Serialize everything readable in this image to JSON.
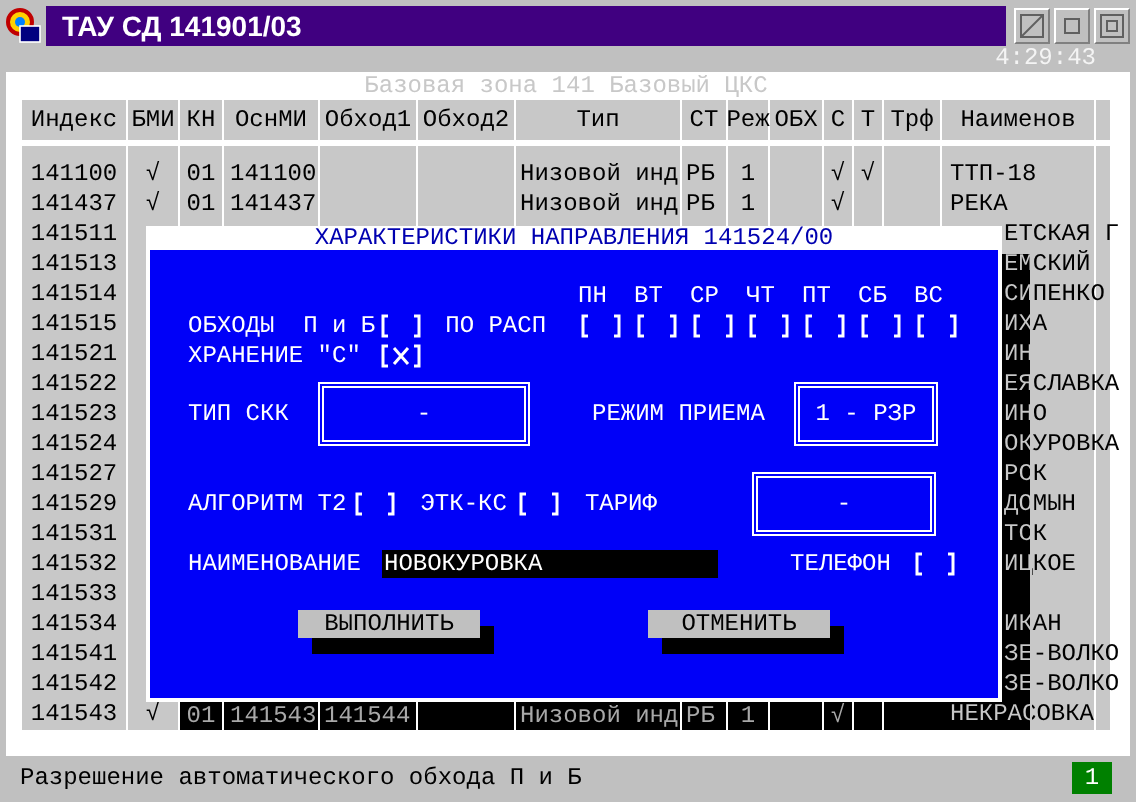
{
  "window": {
    "title": "ТАУ СД 141901/03",
    "clock": "4:29:43"
  },
  "zone_caption": "Базовая зона 141 Базовый ЦКС",
  "table": {
    "columns": [
      "Индекс",
      "БМИ",
      "КН",
      "ОснМИ",
      "Обход1",
      "Обход2",
      "Тип",
      "СТ",
      "Реж",
      "ОБХ",
      "С",
      "Т",
      "Трф",
      "Наименов"
    ],
    "rows": [
      {
        "index": "141100",
        "bmi": "√",
        "kn": "01",
        "osn_mi": "141100",
        "type": "Низовой инд",
        "st": "РБ",
        "mode": "1",
        "c": "√",
        "t": "√",
        "name": "ТТП-18"
      },
      {
        "index": "141437",
        "bmi": "√",
        "kn": "01",
        "osn_mi": "141437",
        "type": "Низовой инд",
        "st": "РБ",
        "mode": "1",
        "c": "√",
        "name": "РЕКА"
      },
      {
        "index": "141511",
        "name": "ЕТСКАЯ Г"
      },
      {
        "index": "141513",
        "name": "ЕМСКИЙ"
      },
      {
        "index": "141514",
        "name": "СИПЕНКО"
      },
      {
        "index": "141515",
        "name": "ИХА"
      },
      {
        "index": "141521",
        "name": "ИН"
      },
      {
        "index": "141522",
        "name": "ЕЯСЛАВКА"
      },
      {
        "index": "141523",
        "name": "ИНО"
      },
      {
        "index": "141524",
        "name": "ОКУРОВКА"
      },
      {
        "index": "141527",
        "name": "РСК"
      },
      {
        "index": "141529",
        "name": "ДОМЫН"
      },
      {
        "index": "141531",
        "name": "ТСК"
      },
      {
        "index": "141532",
        "name": "ИЦКОЕ"
      },
      {
        "index": "141533"
      },
      {
        "index": "141534",
        "name": "ИКАН"
      },
      {
        "index": "141541",
        "name": "ЗЕ-ВОЛКО"
      },
      {
        "index": "141542",
        "name": "ЗЕ-ВОЛКО"
      },
      {
        "index": "141543",
        "bmi": "√",
        "kn": "01",
        "osn_mi": "141543",
        "bypass1": "141544",
        "type": "Низовой инд",
        "st": "РБ",
        "mode": "1",
        "c": "√",
        "name": "НЕКРАСОВКА"
      }
    ]
  },
  "dialog": {
    "title": "ХАРАКТЕРИСТИКИ НАПРАВЛЕНИЯ 141524/00",
    "days": [
      {
        "label": "ПН",
        "checked": false
      },
      {
        "label": "ВТ",
        "checked": false
      },
      {
        "label": "СР",
        "checked": false
      },
      {
        "label": "ЧТ",
        "checked": false
      },
      {
        "label": "ПТ",
        "checked": false
      },
      {
        "label": "СБ",
        "checked": false
      },
      {
        "label": "ВС",
        "checked": false
      }
    ],
    "bypass": {
      "label": "ОБХОДЫ  П и Б",
      "checked": false
    },
    "schedule_label": "ПО РАСП",
    "storage": {
      "label": "ХРАНЕНИЕ \"С\"",
      "checked": true
    },
    "skk_type": {
      "label": "ТИП СКК",
      "value": "-"
    },
    "receive_mode": {
      "label": "РЕЖИМ ПРИЕМА",
      "value": "1 - РЗР"
    },
    "algorithm": {
      "label": "АЛГОРИТМ Т2",
      "checked": false
    },
    "etk": {
      "label": "ЭТК-КС",
      "checked": false
    },
    "tariff": {
      "label": "ТАРИФ",
      "value": "-"
    },
    "name": {
      "label": "НАИМЕНОВАНИЕ",
      "value": "НОВОКУРОВКА"
    },
    "phone": {
      "label": "ТЕЛЕФОН",
      "checked": false
    },
    "buttons": [
      "ВЫПОЛНИТЬ",
      "ОТМЕНИТЬ"
    ]
  },
  "status_bar": {
    "message": "Разрешение автоматического обхода П и Б",
    "indicator": "1"
  }
}
